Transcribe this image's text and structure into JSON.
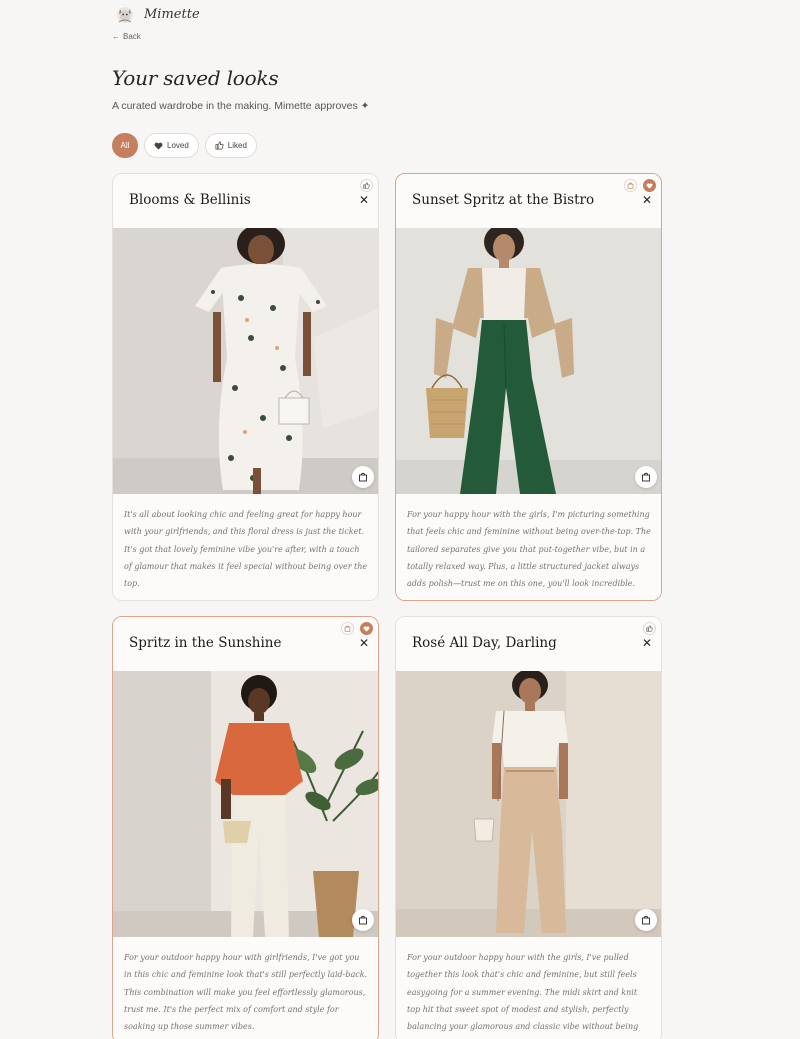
{
  "brand": {
    "name": "Mimette"
  },
  "nav": {
    "back_label": "Back"
  },
  "header": {
    "title": "Your saved looks",
    "subtitle": "A curated wardrobe in the making. Mimette approves ✦"
  },
  "filters": {
    "all_label": "All",
    "loved_label": "Loved",
    "liked_label": "Liked",
    "active": "All"
  },
  "colors": {
    "accent": "#c67f5e",
    "background": "#f8f6f4",
    "card_border": "#e6e0db"
  },
  "looks": [
    {
      "title": "Blooms & Bellinis",
      "status": "liked",
      "description": "It's all about looking chic and feeling great for happy hour with your girlfriends, and this floral dress is just the ticket. It's got that lovely feminine vibe you're after, with a touch of glamour that makes it feel special without being over the top."
    },
    {
      "title": "Sunset Spritz at the Bistro",
      "status": "loved",
      "description": "For your happy hour with the girls, I'm picturing something that feels chic and feminine without being over-the-top. The tailored separates give you that put-together vibe, but in a totally relaxed way. Plus, a little structured jacket always adds polish—trust me on this one, you'll look incredible."
    },
    {
      "title": "Spritz in the Sunshine",
      "status": "loved",
      "description": "For your outdoor happy hour with girlfriends, I've got you in this chic and feminine look that's still perfectly laid-back. This combination will make you feel effortlessly glamorous, trust me. It's the perfect mix of comfort and style for soaking up those summer vibes."
    },
    {
      "title": "Rosé All Day, Darling",
      "status": "liked",
      "description": "For your outdoor happy hour with the girls, I've pulled together this look that's chic and feminine, but still feels easygoing for a summer evening. The midi skirt and knit top hit that sweet spot of modest and stylish, perfectly balancing your glamorous and classic vibe without being overdressed."
    }
  ]
}
